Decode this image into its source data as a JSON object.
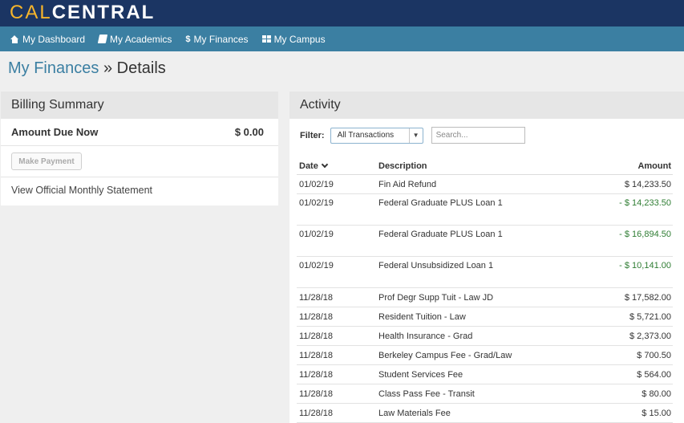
{
  "brand": {
    "cal": "CAL",
    "central": "CENTRAL"
  },
  "nav": [
    {
      "label": "My Dashboard",
      "icon": "home-icon"
    },
    {
      "label": "My Academics",
      "icon": "book-icon"
    },
    {
      "label": "My Finances",
      "icon": "dollar-icon"
    },
    {
      "label": "My Campus",
      "icon": "grid-icon"
    }
  ],
  "breadcrumb": {
    "parent": "My Finances",
    "separator": "»",
    "current": "Details"
  },
  "billing": {
    "title": "Billing Summary",
    "amount_label": "Amount Due Now",
    "amount_value": "$ 0.00",
    "pay_button": "Make Payment",
    "statement_link": "View Official Monthly Statement"
  },
  "activity": {
    "title": "Activity",
    "filter_label": "Filter:",
    "filter_value": "All Transactions",
    "search_placeholder": "Search...",
    "columns": {
      "date": "Date",
      "description": "Description",
      "amount": "Amount"
    },
    "rows": [
      {
        "date": "01/02/19",
        "description": "Fin Aid Refund",
        "amount": "$ 14,233.50",
        "credit": false
      },
      {
        "date": "01/02/19",
        "description": "Federal Graduate PLUS Loan 1",
        "amount": "- $ 14,233.50",
        "credit": true
      },
      {
        "date": "01/02/19",
        "description": "Federal Graduate PLUS Loan 1",
        "amount": "- $ 16,894.50",
        "credit": true
      },
      {
        "date": "01/02/19",
        "description": "Federal Unsubsidized Loan 1",
        "amount": "- $ 10,141.00",
        "credit": true
      },
      {
        "date": "11/28/18",
        "description": "Prof Degr Supp Tuit - Law JD",
        "amount": "$ 17,582.00",
        "credit": false
      },
      {
        "date": "11/28/18",
        "description": "Resident Tuition - Law",
        "amount": "$ 5,721.00",
        "credit": false
      },
      {
        "date": "11/28/18",
        "description": "Health Insurance - Grad",
        "amount": "$ 2,373.00",
        "credit": false
      },
      {
        "date": "11/28/18",
        "description": "Berkeley Campus Fee - Grad/Law",
        "amount": "$ 700.50",
        "credit": false
      },
      {
        "date": "11/28/18",
        "description": "Student Services Fee",
        "amount": "$ 564.00",
        "credit": false
      },
      {
        "date": "11/28/18",
        "description": "Class Pass Fee - Transit",
        "amount": "$ 80.00",
        "credit": false
      },
      {
        "date": "11/28/18",
        "description": "Law Materials Fee",
        "amount": "$ 15.00",
        "credit": false
      }
    ]
  },
  "colors": {
    "topbar": "#1b3563",
    "nav": "#3b7fa2",
    "logo_accent": "#f6b52b",
    "credit": "#2f7d33"
  }
}
